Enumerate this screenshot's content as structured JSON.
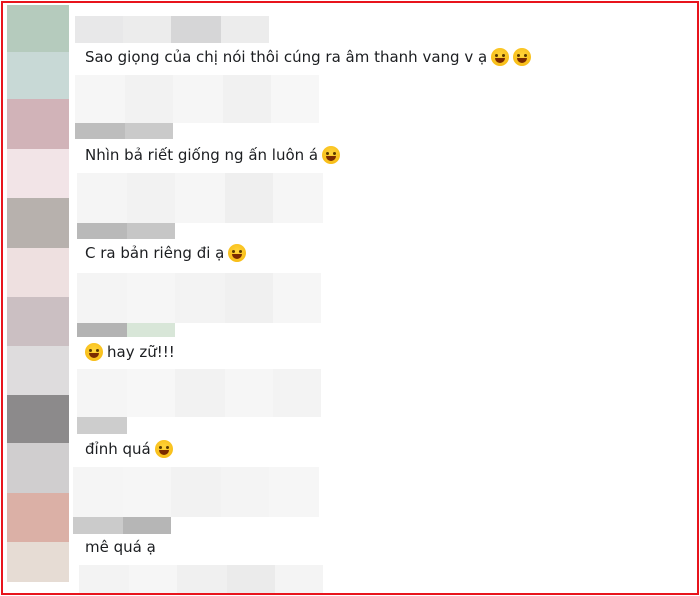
{
  "comments": [
    {
      "text": "Sao giọng của chị nói thôi cúng ra âm thanh vang v ạ",
      "emojis": [
        "sweat-smile-icon",
        "tears-of-joy-icon"
      ]
    },
    {
      "text": "Nhìn bả riết giống ng ấn luôn á",
      "emojis": [
        "grinning-icon"
      ]
    },
    {
      "text": "C ra bản riêng đi ạ",
      "emojis": [
        "loudly-crying-icon"
      ]
    },
    {
      "text": "hay zữ!!!",
      "emojis": [
        "pleading-face-icon"
      ],
      "emoji_first": true
    },
    {
      "text": "đỉnh quá",
      "emojis": [
        "smiling-hearts-icon"
      ]
    },
    {
      "text": "mê quá ạ",
      "emojis": []
    }
  ],
  "colors": {
    "frame": "#e8141c",
    "text": "#1c1e21"
  }
}
